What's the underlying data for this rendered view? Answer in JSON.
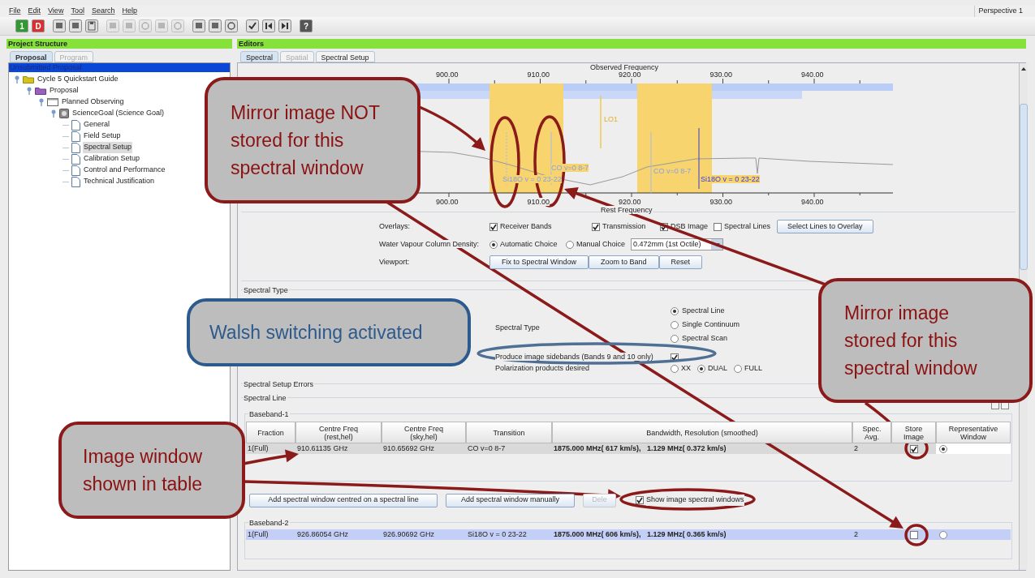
{
  "menu_bar": {
    "items": [
      "File",
      "Edit",
      "View",
      "Tool",
      "Search",
      "Help"
    ],
    "perspective": "Perspective 1"
  },
  "toolbar": [
    {
      "kind": "glyph",
      "glyph": "1",
      "color": "#2f9a2f",
      "disabled": false
    },
    {
      "kind": "glyph",
      "glyph": "D",
      "color": "#d83030",
      "disabled": false
    },
    {
      "kind": "page",
      "disabled": false
    },
    {
      "kind": "page",
      "disabled": false
    },
    {
      "kind": "disk",
      "disabled": false
    },
    {
      "kind": "page",
      "disabled": true
    },
    {
      "kind": "page",
      "disabled": true
    },
    {
      "kind": "box",
      "disabled": true
    },
    {
      "kind": "page",
      "disabled": true
    },
    {
      "kind": "box",
      "disabled": true
    },
    {
      "kind": "page",
      "disabled": false
    },
    {
      "kind": "page",
      "disabled": false
    },
    {
      "kind": "box",
      "disabled": false
    },
    {
      "kind": "check",
      "disabled": false
    },
    {
      "kind": "back",
      "disabled": false
    },
    {
      "kind": "forward",
      "disabled": false
    },
    {
      "kind": "glyph",
      "glyph": "?",
      "color": "#555555",
      "disabled": false
    }
  ],
  "project_structure": {
    "title": "Project Structure",
    "tabs": [
      {
        "label": "Proposal",
        "selected": true
      },
      {
        "label": "Program",
        "selected": false
      }
    ],
    "root": "Unsubmitted Proposal",
    "tree": [
      {
        "label": "Cycle 5 Quickstart Guide",
        "kind": "folder",
        "expanded": true,
        "selected": false,
        "children": [
          {
            "label": "Proposal",
            "kind": "proposal",
            "expanded": true,
            "selected": false,
            "children": [
              {
                "label": "Planned Observing",
                "kind": "observing",
                "expanded": true,
                "selected": false,
                "children": [
                  {
                    "label": "ScienceGoal (Science Goal)",
                    "kind": "goal",
                    "expanded": true,
                    "selected": false,
                    "children": [
                      {
                        "label": "General",
                        "kind": "page",
                        "expanded": false,
                        "selected": false
                      },
                      {
                        "label": "Field Setup",
                        "kind": "page",
                        "expanded": false,
                        "selected": false
                      },
                      {
                        "label": "Spectral Setup",
                        "kind": "page",
                        "expanded": false,
                        "selected": true
                      },
                      {
                        "label": "Calibration Setup",
                        "kind": "page",
                        "expanded": false,
                        "selected": false
                      },
                      {
                        "label": "Control and Performance",
                        "kind": "page",
                        "expanded": false,
                        "selected": false
                      },
                      {
                        "label": "Technical Justification",
                        "kind": "page",
                        "expanded": false,
                        "selected": false
                      }
                    ]
                  }
                ]
              }
            ]
          }
        ]
      }
    ]
  },
  "editors": {
    "title": "Editors",
    "tabs": [
      {
        "label": "Spectral",
        "selected": true,
        "disabled": false
      },
      {
        "label": "Spatial",
        "selected": false,
        "disabled": true
      },
      {
        "label": "Spectral Setup",
        "selected": false,
        "disabled": false
      }
    ],
    "plot": {
      "top_axis_label": "Observed Frequency",
      "bottom_axis_label": "Rest Frequency",
      "top_ticks": [
        "900.00",
        "910.00",
        "920.00",
        "930.00",
        "940.00"
      ],
      "bottom_ticks": [
        "900.00",
        "910.00",
        "920.00",
        "930.00",
        "940.00"
      ],
      "line_labels": [
        {
          "text": "LO1",
          "kind": "lo"
        },
        {
          "text": "CO v=0 8-7",
          "kind": "image"
        },
        {
          "text": "Si18O v = 0 23-22",
          "kind": "image"
        },
        {
          "text": "CO v=0 8-7",
          "kind": "image"
        },
        {
          "text": "Si18O v = 0 23-22",
          "kind": "signal"
        }
      ]
    },
    "overlays": {
      "label": "Overlays:",
      "options": [
        {
          "label": "Receiver Bands",
          "checked": true
        },
        {
          "label": "Transmission",
          "checked": true
        },
        {
          "label": "DSB Image",
          "checked": true
        },
        {
          "label": "Spectral Lines",
          "checked": false
        }
      ],
      "button": "Select Lines to Overlay"
    },
    "water_vapour": {
      "label": "Water Vapour Column Density:",
      "options": [
        {
          "label": "Automatic Choice",
          "selected": true
        },
        {
          "label": "Manual Choice",
          "selected": false
        }
      ],
      "value": "0.472mm (1st Octile)"
    },
    "viewport": {
      "label": "Viewport:",
      "buttons": [
        "Fix to Spectral Window",
        "Zoom to Band",
        "Reset"
      ]
    },
    "spectral_type": {
      "title": "Spectral Type",
      "label": "Spectral Type",
      "options": [
        {
          "label": "Spectral Line",
          "selected": true
        },
        {
          "label": "Single Continuum",
          "selected": false
        },
        {
          "label": "Spectral Scan",
          "selected": false
        }
      ],
      "sidebands": {
        "label": "Produce image sidebands (Bands 9 and 10 only)",
        "checked": true
      },
      "polarization": {
        "label": "Polarization products desired",
        "options": [
          {
            "label": "XX",
            "selected": false
          },
          {
            "label": "DUAL",
            "selected": true
          },
          {
            "label": "FULL",
            "selected": false
          }
        ]
      }
    },
    "errors_title": "Spectral Setup Errors",
    "spectral_line": {
      "title": "Spectral Line",
      "columns": [
        {
          "title": "Fraction"
        },
        {
          "title": "Centre Freq",
          "subtitle": "(rest,hel)"
        },
        {
          "title": "Centre Freq",
          "subtitle": "(sky,hel)"
        },
        {
          "title": "Transition"
        },
        {
          "title": "Bandwidth, Resolution (smoothed)"
        },
        {
          "title": "Spec.",
          "subtitle": "Avg."
        },
        {
          "title": "Store",
          "subtitle": "Image"
        },
        {
          "title": "Representative",
          "subtitle": "Window"
        }
      ],
      "basebands": [
        {
          "title": "Baseband-1",
          "rows": [
            {
              "fraction": "1(Full)",
              "rest": "910.61135 GHz",
              "sky": "910.65692 GHz",
              "transition": "CO v=0 8-7",
              "bandwidth": "1875.000 MHz( 617 km/s),   1.129 MHz( 0.372 km/s)",
              "avg": "2",
              "store_image": true,
              "representative": true,
              "selected": false
            }
          ]
        },
        {
          "title": "Baseband-2",
          "rows": [
            {
              "fraction": "1(Full)",
              "rest": "926.86054 GHz",
              "sky": "926.90692 GHz",
              "transition": "Si18O v = 0 23-22",
              "bandwidth": "1875.000 MHz( 606 km/s),   1.129 MHz( 0.365 km/s)",
              "avg": "2",
              "store_image": false,
              "representative": false,
              "selected": true
            }
          ]
        }
      ],
      "buttons": [
        {
          "label": "Add spectral window centred on a spectral line",
          "disabled": false
        },
        {
          "label": "Add spectral window manually",
          "disabled": false
        },
        {
          "label": "Dele",
          "disabled": true
        }
      ],
      "show_image": {
        "label": "Show image spectral windows",
        "checked": true
      }
    }
  },
  "annotations": [
    {
      "text": "Mirror image NOT stored for this spectral window",
      "kind": "red"
    },
    {
      "text": "Walsh switching activated",
      "kind": "blue"
    },
    {
      "text": "Mirror image stored for this spectral window",
      "kind": "red"
    },
    {
      "text": "Image window shown in table",
      "kind": "red"
    }
  ]
}
